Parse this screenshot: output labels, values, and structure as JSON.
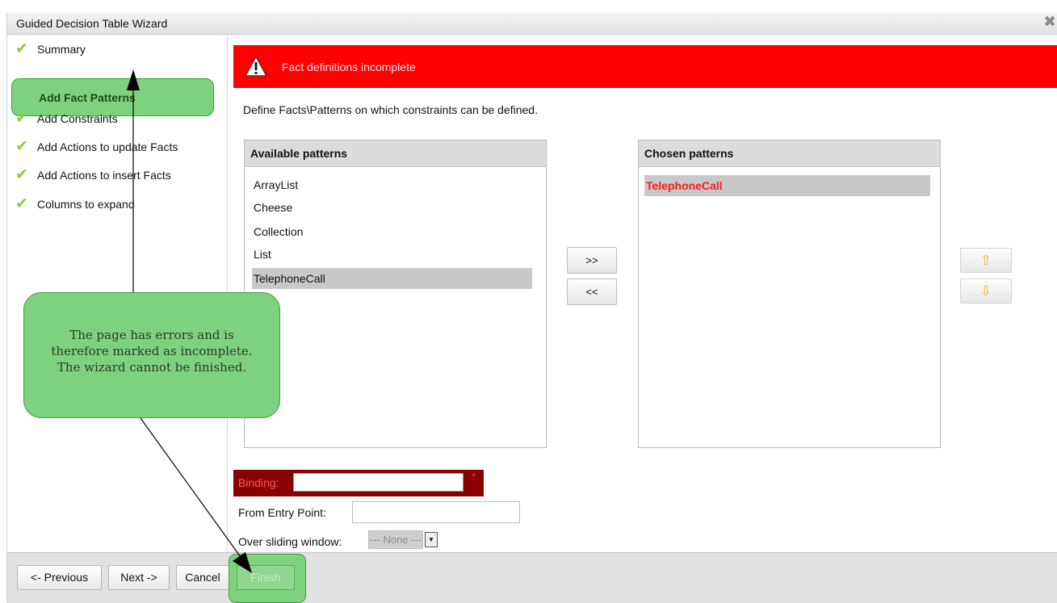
{
  "window": {
    "title": "Guided Decision Table Wizard",
    "close_icon": "close-x-icon"
  },
  "nav": {
    "items": [
      {
        "label": "Summary",
        "status": "complete"
      },
      {
        "label": "Add Fact Patterns",
        "status": "incomplete",
        "current": true
      },
      {
        "label": "Add Constraints",
        "status": "complete"
      },
      {
        "label": "Add Actions to update Facts",
        "status": "complete"
      },
      {
        "label": "Add Actions to insert Facts",
        "status": "complete"
      },
      {
        "label": "Columns to expand",
        "status": "complete"
      }
    ]
  },
  "error": {
    "icon": "warning-triangle-icon",
    "message": "Fact definitions incomplete"
  },
  "description": "Define Facts\\Patterns on which constraints can be defined.",
  "available": {
    "header": "Available patterns",
    "items": [
      "ArrayList",
      "Cheese",
      "Collection",
      "List",
      "TelephoneCall"
    ],
    "selected": "TelephoneCall"
  },
  "chosen": {
    "header": "Chosen patterns",
    "items": [
      "TelephoneCall"
    ]
  },
  "buttons": {
    "add": ">>",
    "remove": "<<",
    "move_up_icon": "arrow-up-icon",
    "move_down_icon": "arrow-down-icon"
  },
  "form": {
    "binding_label": "Binding:",
    "binding_value": "",
    "binding_required": "*",
    "from_label": "From Entry Point:",
    "from_value": "",
    "window_label": "Over sliding window:",
    "window_value": "--- None ---"
  },
  "footer": {
    "previous": "<- Previous",
    "next": "Next ->",
    "cancel": "Cancel",
    "finish": "Finish"
  },
  "callout": {
    "lines": [
      "The page has errors and is",
      "therefore marked as incomplete.",
      "The wizard cannot be finished."
    ]
  },
  "colors": {
    "error": "#ff0000",
    "highlight": "#7ed27e",
    "check": "#8ecc3a",
    "chosen_text": "#ff1a1a"
  }
}
